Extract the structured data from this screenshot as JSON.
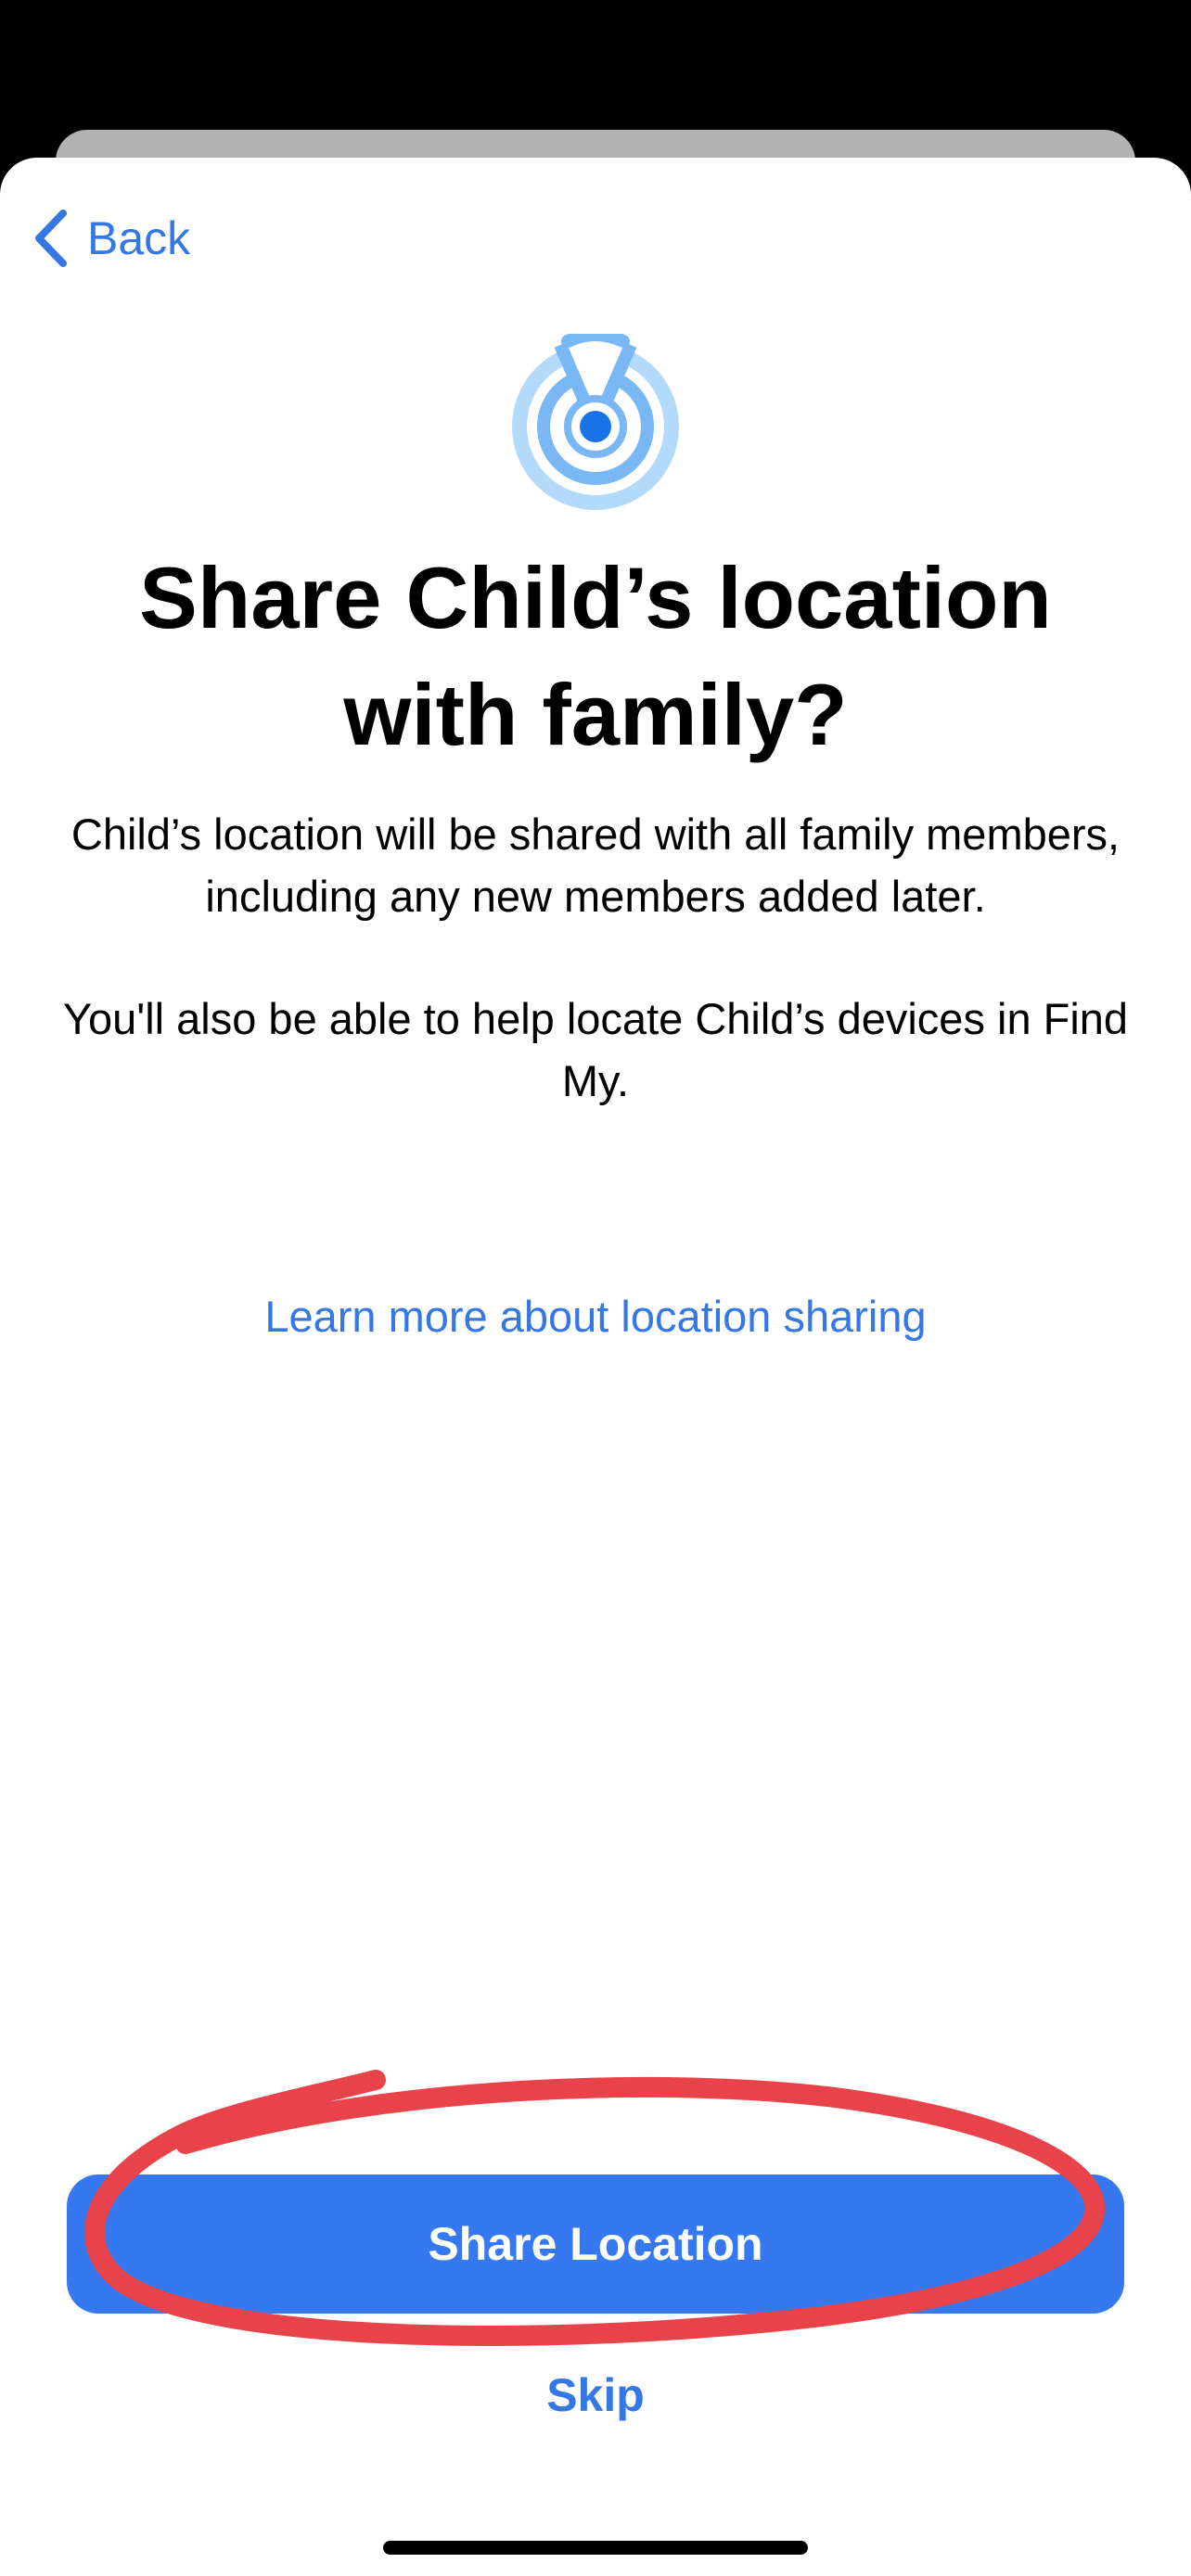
{
  "nav": {
    "back_label": "Back",
    "back_icon": "chevron-left-icon"
  },
  "hero": {
    "icon": "location-sharing-icon"
  },
  "content": {
    "title": "Share Child’s location with family?",
    "paragraph_1": "Child’s location will be shared with all family members, including any new members added later.",
    "paragraph_2": "You'll also be able to help locate Child’s devices in Find My.",
    "learn_more_link": "Learn more about location sharing"
  },
  "actions": {
    "primary_label": "Share Location",
    "secondary_label": "Skip"
  },
  "colors": {
    "accent": "#3578e5",
    "primary_button": "#3578f0",
    "annotation_stroke": "#e8434a",
    "icon_light": "#b3d9fb",
    "icon_mid": "#7ab8f5",
    "icon_dot": "#1a73e8"
  }
}
